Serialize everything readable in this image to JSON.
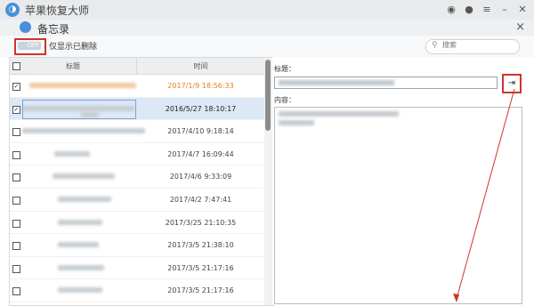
{
  "app": {
    "title": "苹果恢复大师"
  },
  "window_controls": [
    "weibo-icon",
    "chat-icon",
    "menu-icon",
    "minimize-icon",
    "close-icon"
  ],
  "module": {
    "title": "备忘录",
    "close": "×"
  },
  "toolbar": {
    "toggle_state": "OFF",
    "toggle_label": "仅显示已删除",
    "search_placeholder": "搜索"
  },
  "table": {
    "headers": {
      "title": "标题",
      "time": "时间"
    },
    "rows": [
      {
        "checked": true,
        "time": "2017/1/9 18:56:33",
        "style": "orange"
      },
      {
        "checked": true,
        "time": "2016/5/27 18:10:17",
        "style": "selected"
      },
      {
        "checked": false,
        "time": "2017/4/10 9:18:14",
        "style": "normal"
      },
      {
        "checked": false,
        "time": "2017/4/7 16:09:44",
        "style": "normal"
      },
      {
        "checked": false,
        "time": "2017/4/6 9:33:09",
        "style": "normal"
      },
      {
        "checked": false,
        "time": "2017/4/2 7:47:41",
        "style": "normal"
      },
      {
        "checked": false,
        "time": "2017/3/25 21:10:35",
        "style": "normal"
      },
      {
        "checked": false,
        "time": "2017/3/5 21:38:10",
        "style": "normal"
      },
      {
        "checked": false,
        "time": "2017/3/5 21:17:16",
        "style": "normal"
      },
      {
        "checked": false,
        "time": "2017/3/5 21:17:16",
        "style": "normal"
      }
    ]
  },
  "detail": {
    "title_label": "标题：",
    "content_label": "内容："
  },
  "colors": {
    "accent_red": "#d0342c",
    "orange_time": "#e0851a",
    "selection": "#dce8f5"
  }
}
